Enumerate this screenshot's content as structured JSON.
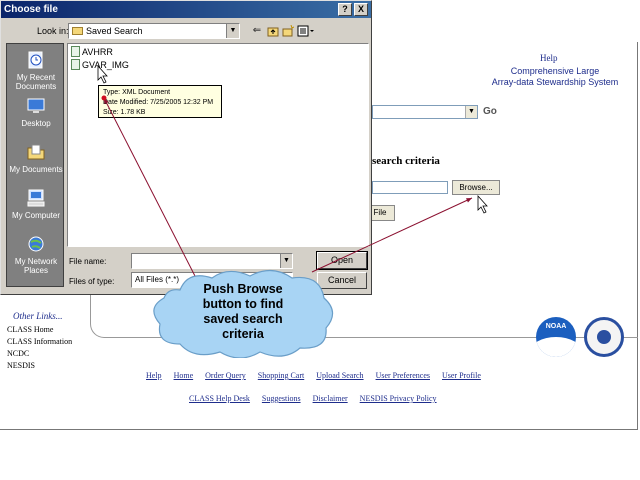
{
  "dialog": {
    "title": "Choose file",
    "title_buttons": {
      "help": "?",
      "close": "X"
    },
    "look_in": {
      "label": "Look in:",
      "value": "Saved Search"
    },
    "places": [
      {
        "label": "My Recent Documents"
      },
      {
        "label": "Desktop"
      },
      {
        "label": "My Documents"
      },
      {
        "label": "My Computer"
      },
      {
        "label": "My Network Places"
      }
    ],
    "files": [
      {
        "name": "AVHRR"
      },
      {
        "name": "GVAR_IMG"
      }
    ],
    "tooltip": {
      "type": "Type: XML Document",
      "date": "Date Modified: 7/25/2005 12:32 PM",
      "size": "Size: 1.78 KB"
    },
    "file_name": {
      "label": "File name:",
      "value": ""
    },
    "files_of_type": {
      "label": "Files of type:",
      "value": "All Files (*.*)"
    },
    "open_label": "Open",
    "cancel_label": "Cancel"
  },
  "web": {
    "help": "Help",
    "site_title_line1": "Comprehensive Large",
    "site_title_line2": "Array-data Stewardship System",
    "go": "Go",
    "search_criteria_heading": "search criteria",
    "browse_label": "Browse...",
    "file_button_label": "File",
    "other_links": {
      "heading": "Other Links...",
      "items": [
        "CLASS Home",
        "CLASS Information",
        "NCDC",
        "NESDIS"
      ]
    },
    "logos": {
      "noaa": "NOAA"
    },
    "nav_primary": [
      "Help",
      "Home",
      "Order Query",
      "Shopping Cart",
      "Upload Search",
      "User Preferences",
      "User Profile"
    ],
    "nav_secondary": [
      "CLASS Help Desk",
      "Suggestions",
      "Disclaimer",
      "NESDIS Privacy Policy"
    ]
  },
  "annotation": {
    "line1": "Push Browse",
    "line2": "button to find",
    "line3": "saved search",
    "line4": "criteria",
    "arrow_color": "#8b1030",
    "cloud_color": "#a8d4f4"
  }
}
